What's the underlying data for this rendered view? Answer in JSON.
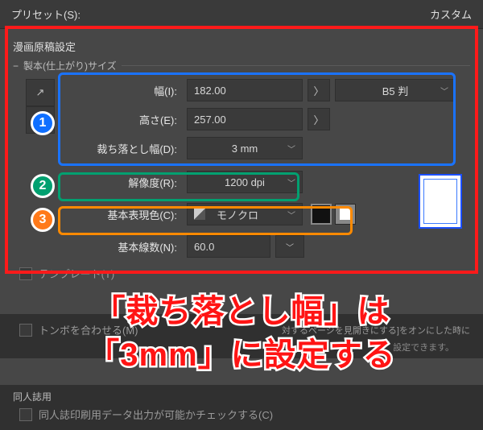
{
  "topbar": {
    "preset_label": "プリセット(S):",
    "preset_value": "カスタム"
  },
  "section": {
    "title": "漫画原稿設定",
    "bind_title": "製本(仕上がり)サイズ"
  },
  "fields": {
    "width_label": "幅(I):",
    "width_value": "182.00",
    "height_label": "高さ(E):",
    "height_value": "257.00",
    "bleed_label": "裁ち落とし幅(D):",
    "bleed_value": "3 mm",
    "paper_preset": "B5 判",
    "resolution_label": "解像度(R):",
    "resolution_value": "1200 dpi",
    "color_label": "基本表現色(C):",
    "color_value": "モノクロ",
    "lines_label": "基本線数(N):",
    "lines_value": "60.0"
  },
  "badges": {
    "b1": "1",
    "b2": "2",
    "b3": "3"
  },
  "lower": {
    "template": "テンプレート(T)",
    "tombo": "トンボを合わせる(M)",
    "dim_text1": "対するページを見開きにする]をオンにした時に",
    "dim_text2": "設定できます。",
    "doujin_title": "同人誌用",
    "doujin_check": "同人誌印刷用データ出力が可能かチェックする(C)"
  },
  "caption": {
    "line1": "「裁ち落とし幅」は",
    "line2": "「3mm」に設定する"
  }
}
